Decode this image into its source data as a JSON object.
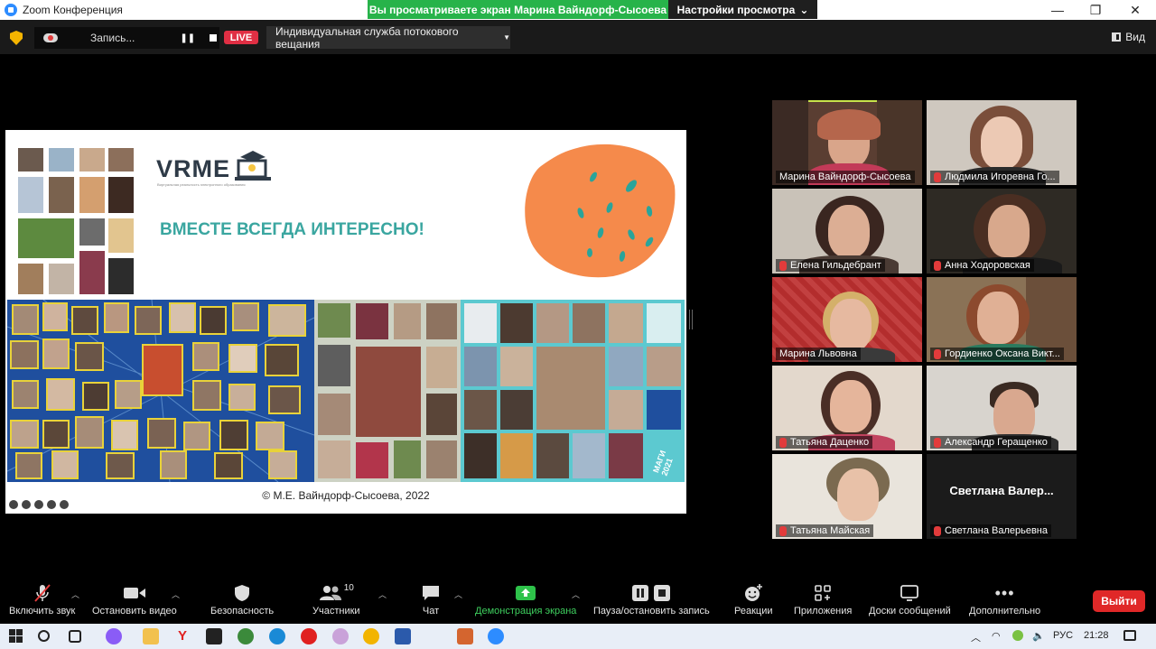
{
  "window": {
    "title": "Zoom Конференция",
    "share_banner": "Вы просматриваете экран Марина Вайндорф-Сысоева",
    "view_options": "Настройки просмотра"
  },
  "topbar": {
    "recording_label": "Запись...",
    "live_label": "LIVE",
    "stream_service": "Индивидуальная служба потокового вещания",
    "view_label": "Вид"
  },
  "slide": {
    "logo": "VRME",
    "logo_caption": "Виртуальная реальность электронного образования",
    "slogan": "ВМЕСТЕ ВСЕГДА ИНТЕРЕСНО!",
    "badge": "МАГИ 2021",
    "copyright": "© М.Е. Вайндорф-Сысоева, 2022",
    "colors": {
      "orange": "#f58a4b",
      "teal": "#3aa6a0",
      "blue": "#1f4f9e",
      "cyan": "#5cc9d0"
    }
  },
  "participants": [
    {
      "name": "Марина Вайндорф-Сысоева",
      "muted": false,
      "active": true
    },
    {
      "name": "Людмила Игоревна Го...",
      "muted": true
    },
    {
      "name": "Елена Гильдебрант",
      "muted": true
    },
    {
      "name": "Анна Ходоровская",
      "muted": true
    },
    {
      "name": "Марина Львовна",
      "muted": false
    },
    {
      "name": "Гордиенко Оксана Викт...",
      "muted": true
    },
    {
      "name": "Татьяна Даценко",
      "muted": true
    },
    {
      "name": "Александр Геращенко",
      "muted": true
    },
    {
      "name": "Татьяна Майская",
      "muted": true
    },
    {
      "name": "Светлана Валерьевна",
      "muted": true,
      "display_name": "Светлана  Валер..."
    }
  ],
  "toolbar": {
    "mute": "Включить звук",
    "video": "Остановить видео",
    "security": "Безопасность",
    "participants": "Участники",
    "participants_count": "10",
    "chat": "Чат",
    "share": "Демонстрация экрана",
    "record": "Пауза/остановить запись",
    "reactions": "Реакции",
    "apps": "Приложения",
    "whiteboard": "Доски сообщений",
    "more": "Дополнительно",
    "leave": "Выйти"
  },
  "taskbar": {
    "language": "РУС",
    "time": "21:28"
  }
}
